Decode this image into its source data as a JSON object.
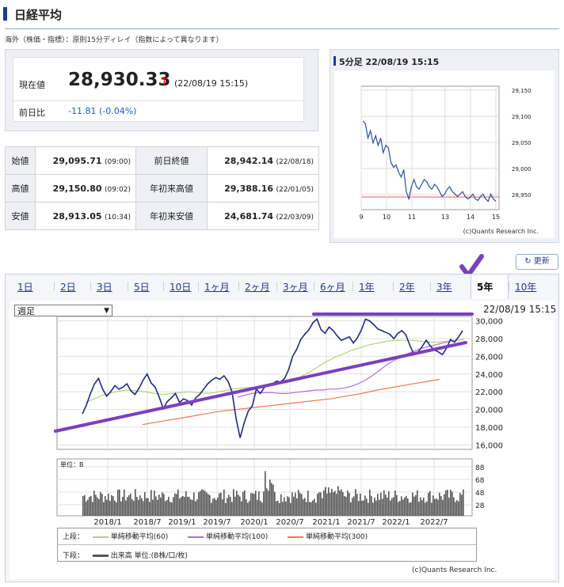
{
  "page_title": "日経平均",
  "notice": "海外（株価・指標）：原則15分ディレイ（指数によって異なります）",
  "current": {
    "label": "現在値",
    "value": "28,930.33",
    "arrow": "↑",
    "time": "(22/08/19 15:15)"
  },
  "change": {
    "label": "前日比",
    "value": "-11.81 (-0.04%)"
  },
  "stats": {
    "rows": [
      [
        {
          "label": "始値",
          "value": "29,095.71",
          "note": "(09:00)"
        },
        {
          "label": "前日終値",
          "value": "28,942.14",
          "note": "(22/08/18)"
        }
      ],
      [
        {
          "label": "高値",
          "value": "29,150.80",
          "note": "(09:02)"
        },
        {
          "label": "年初来高値",
          "value": "29,388.16",
          "note": "(22/01/05)"
        }
      ],
      [
        {
          "label": "安値",
          "value": "28,913.05",
          "note": "(10:34)"
        },
        {
          "label": "年初来安値",
          "value": "24,681.74",
          "note": "(22/03/09)"
        }
      ]
    ]
  },
  "mini_chart": {
    "title": "5分足 22/08/19 15:15",
    "y_ticks": [
      "29,150",
      "29,100",
      "29,050",
      "29,000",
      "28,950"
    ],
    "x_ticks": [
      "9",
      "10",
      "11",
      "13",
      "14",
      "15"
    ],
    "credit": "(c)Quants Research Inc."
  },
  "refresh_label": "更新",
  "tabs": [
    "1日",
    "2日",
    "3日",
    "5日",
    "10日",
    "1ヶ月",
    "2ヶ月",
    "3ヶ月",
    "6ヶ月",
    "1年",
    "2年",
    "3年",
    "5年",
    "10年"
  ],
  "active_tab": "5年",
  "select": {
    "value": "週足"
  },
  "chart_time": "22/08/19 15:15",
  "chart_data": {
    "type": "line",
    "title": "",
    "x_ticks": [
      "2018/1",
      "2018/7",
      "2019/1",
      "2019/7",
      "2020/1",
      "2020/7",
      "2021/1",
      "2021/7",
      "2022/1",
      "2022/7"
    ],
    "y_ticks": [
      "30,000",
      "28,000",
      "26,000",
      "24,000",
      "22,000",
      "20,000",
      "18,000",
      "16,000"
    ],
    "ylim": [
      15500,
      30500
    ],
    "series": [
      {
        "name": "price",
        "color": "#1f2a8a",
        "values": [
          19500,
          20500,
          21800,
          22900,
          23500,
          22300,
          21500,
          22000,
          22700,
          22300,
          22500,
          22900,
          22100,
          21700,
          22400,
          23300,
          24000,
          23000,
          22500,
          21400,
          20100,
          20900,
          21300,
          21800,
          20800,
          21200,
          21000,
          20500,
          21300,
          21700,
          22300,
          22900,
          23300,
          23600,
          23400,
          23800,
          23200,
          22000,
          19000,
          16800,
          18500,
          19800,
          20400,
          22300,
          21800,
          22500,
          22800,
          22900,
          23200,
          23100,
          23500,
          24500,
          26000,
          26800,
          27900,
          28500,
          29000,
          29800,
          30200,
          29000,
          28600,
          29300,
          28900,
          28300,
          27800,
          28000,
          28200,
          27500,
          28100,
          29000,
          30200,
          30000,
          29600,
          29100,
          28900,
          28700,
          28500,
          28000,
          28600,
          28900,
          28400,
          27200,
          26200,
          26500,
          27100,
          27800,
          27200,
          26700,
          26500,
          26200,
          26900,
          27900,
          27600,
          28200,
          28900
        ]
      },
      {
        "name": "単純移動平均(60)",
        "color": "#b7d17a",
        "values": [
          20800,
          21200,
          21600,
          21900,
          22100,
          22200,
          22100,
          22000,
          21800,
          21700,
          21800,
          21900,
          22000,
          21900,
          21800,
          21900,
          22100,
          22300,
          22400,
          22500,
          22500,
          22600,
          22800,
          23000,
          23300,
          23700,
          24200,
          24800,
          25400,
          25900,
          26300,
          26700,
          27000,
          27300,
          27500,
          27700,
          27800,
          27800,
          27800,
          27700,
          27600,
          27600,
          27700,
          27800,
          27900
        ]
      },
      {
        "name": "単純移動平均(100)",
        "color": "#b36be6",
        "values": [
          21400,
          21600,
          21800,
          21900,
          21900,
          21900,
          21800,
          21800,
          21900,
          22000,
          22100,
          22200,
          22200,
          22300,
          22300,
          22400,
          22600,
          22900,
          23300,
          23800,
          24400,
          25000,
          25500,
          25900,
          26300,
          26600,
          26900,
          27100,
          27300,
          27500,
          27700,
          27800,
          27900
        ]
      },
      {
        "name": "単純移動平均(300)",
        "color": "#ef7a4b",
        "values": [
          18300,
          18600,
          18900,
          19200,
          19500,
          19800,
          20000,
          20200,
          20400,
          20600,
          20800,
          21000,
          21200,
          21500,
          21800,
          22200,
          22500,
          22800,
          23100,
          23400
        ]
      }
    ],
    "volume": {
      "label": "単位：B",
      "ticks": [
        "88",
        "68",
        "48",
        "28"
      ],
      "ylim": [
        0,
        98
      ]
    },
    "legend": {
      "upper_label": "上段：",
      "lower_label": "下段：",
      "upper_items": [
        "単純移動平均(60)",
        "単純移動平均(100)",
        "単純移動平均(300)"
      ],
      "lower_item": "出来高 単位:(B株/口/枚)"
    },
    "credit": "(c)Quants Research Inc."
  }
}
